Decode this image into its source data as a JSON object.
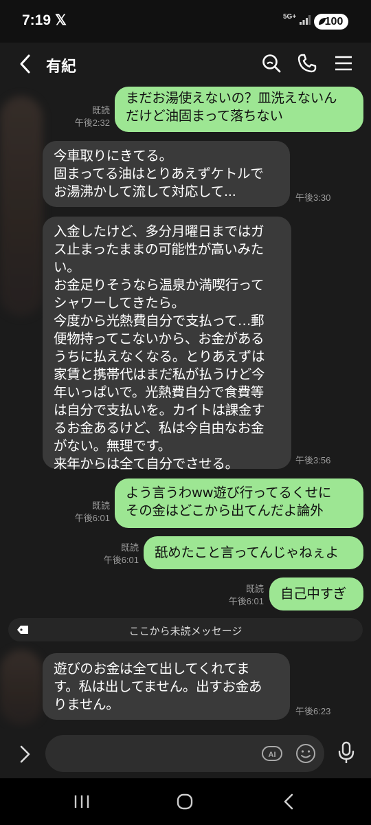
{
  "status_bar": {
    "time": "7:19",
    "app_icon": "x-logo-icon",
    "network": "5G+",
    "battery": "100"
  },
  "header": {
    "contact_name": "有紀",
    "icons": [
      "back-icon",
      "search-icon",
      "phone-icon",
      "menu-icon"
    ]
  },
  "messages": [
    {
      "dir": "out",
      "lines": [
        "まだお湯使えないの？皿洗えないん",
        "だけど油固まって落ちない"
      ],
      "read": "既読",
      "time": "午後2:32"
    },
    {
      "dir": "in",
      "lines": [
        "今車取りにきてる。",
        "固まってる油はとりあえずケトルで",
        "お湯沸かして流して対応して..."
      ],
      "time": "午後3:30"
    },
    {
      "dir": "in",
      "lines": [
        "入金したけど、多分月曜日まではガ",
        "ス止まったままの可能性が高いみた",
        "い。",
        "お金足りそうなら温泉か満喫行って",
        "シャワーしてきたら。",
        "今度から光熱費自分で支払って…郵",
        "便物持ってこないから、お金がある",
        "うちに払えなくなる。とりあえずは",
        "家賃と携帯代はまだ私が払うけど今",
        "年いっぱいで。光熱費自分で食費等",
        "は自分で支払いを。カイトは課金す",
        "るお金あるけど、私は今自由なお金",
        "がない。無理です。",
        "来年からは全て自分でさせる。"
      ],
      "time": "午後3:56"
    },
    {
      "dir": "out",
      "lines": [
        "よう言うわww遊び行ってるくせに",
        "その金はどこから出てんだよ論外"
      ],
      "read": "既読",
      "time": "午後6:01"
    },
    {
      "dir": "out",
      "lines": [
        "舐めたこと言ってんじゃねぇよ"
      ],
      "read": "既読",
      "time": "午後6:01"
    },
    {
      "dir": "out",
      "lines": [
        "自己中すぎ"
      ],
      "read": "既読",
      "time": "午後6:01"
    },
    {
      "dir": "in",
      "lines": [
        "遊びのお金は全て出してくれてま",
        "す。私は出してません。出すお金あ",
        "りません。"
      ],
      "time": "午後6:23"
    }
  ],
  "unread_divider": {
    "label": "ここから未読メッセージ"
  },
  "input": {
    "placeholder": "",
    "ai_label": "AI"
  },
  "colors": {
    "outgoing_bubble": "#9de693",
    "incoming_bubble": "#3a3a3a",
    "background": "#1b1b1b"
  }
}
